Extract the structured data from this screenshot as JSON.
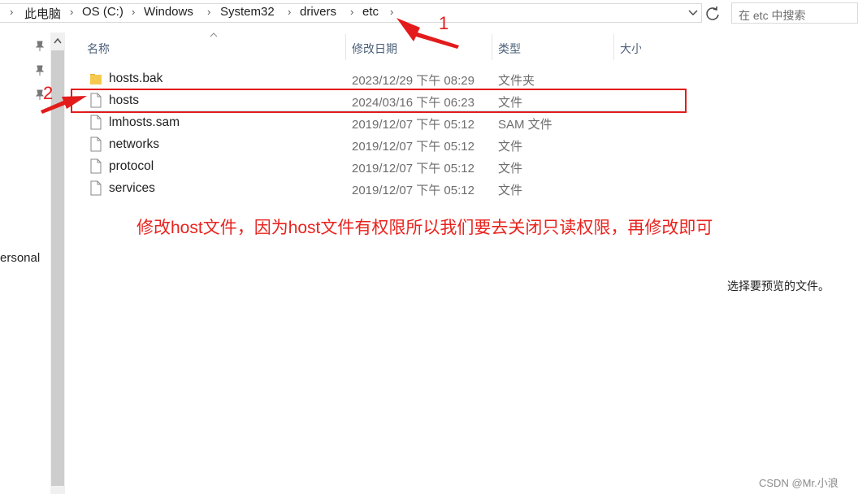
{
  "address": {
    "crumbs": [
      "此电脑",
      "OS (C:)",
      "Windows",
      "System32",
      "drivers",
      "etc"
    ],
    "search_placeholder": "在 etc 中搜索"
  },
  "left_pane": {
    "partial_label": "ersonal"
  },
  "columns": {
    "name": "名称",
    "date": "修改日期",
    "type": "类型",
    "size": "大小"
  },
  "files": [
    {
      "name": "hosts.bak",
      "date": "2023/12/29 下午 08:29",
      "type": "文件夹",
      "icon": "folder-icon"
    },
    {
      "name": "hosts",
      "date": "2024/03/16 下午 06:23",
      "type": "文件",
      "icon": "file-icon"
    },
    {
      "name": "lmhosts.sam",
      "date": "2019/12/07 下午 05:12",
      "type": "SAM 文件",
      "icon": "file-icon"
    },
    {
      "name": "networks",
      "date": "2019/12/07 下午 05:12",
      "type": "文件",
      "icon": "file-icon"
    },
    {
      "name": "protocol",
      "date": "2019/12/07 下午 05:12",
      "type": "文件",
      "icon": "file-icon"
    },
    {
      "name": "services",
      "date": "2019/12/07 下午 05:12",
      "type": "文件",
      "icon": "file-icon"
    }
  ],
  "annotation": {
    "marker_1": "1",
    "marker_2": "2",
    "note": "修改host文件，因为host文件有权限所以我们要去关闭只读权限，再修改即可",
    "color": "#e31b1b"
  },
  "preview_text": "选择要预览的文件。",
  "watermark": "CSDN @Mr.小浪"
}
